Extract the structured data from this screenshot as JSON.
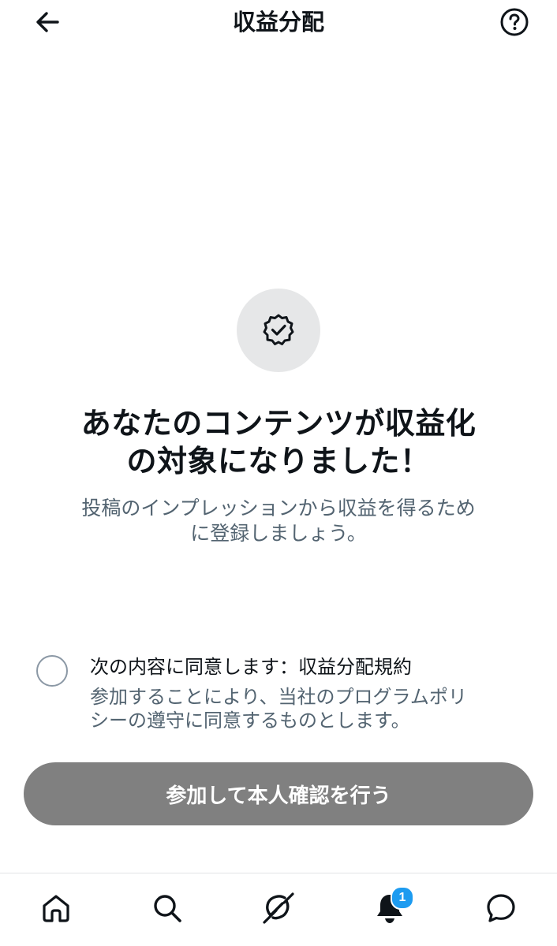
{
  "header": {
    "title": "収益分配",
    "back_icon": "arrow-left-icon",
    "help_icon": "question-circle-icon"
  },
  "hero": {
    "icon": "verified-badge-icon",
    "headline_line1": "あなたのコンテンツが収益化",
    "headline_line2": "の対象になりました！",
    "sub_line1": "投稿のインプレッションから収益を得るため",
    "sub_line2": "に登録しましょう。"
  },
  "agreement": {
    "checked": false,
    "title": "次の内容に同意します：収益分配規約",
    "desc_line1": "参加することにより、当社のプログラムポリ",
    "desc_line2": "シーの遵守に同意するものとします。"
  },
  "cta": {
    "label": "参加して本人確認を行う",
    "color": "#808080"
  },
  "bottom_nav": {
    "items": [
      {
        "icon": "home-icon"
      },
      {
        "icon": "search-icon"
      },
      {
        "icon": "grok-icon"
      },
      {
        "icon": "bell-icon",
        "badge": "1"
      },
      {
        "icon": "message-icon"
      }
    ],
    "badge_color": "#1d9bf0"
  }
}
